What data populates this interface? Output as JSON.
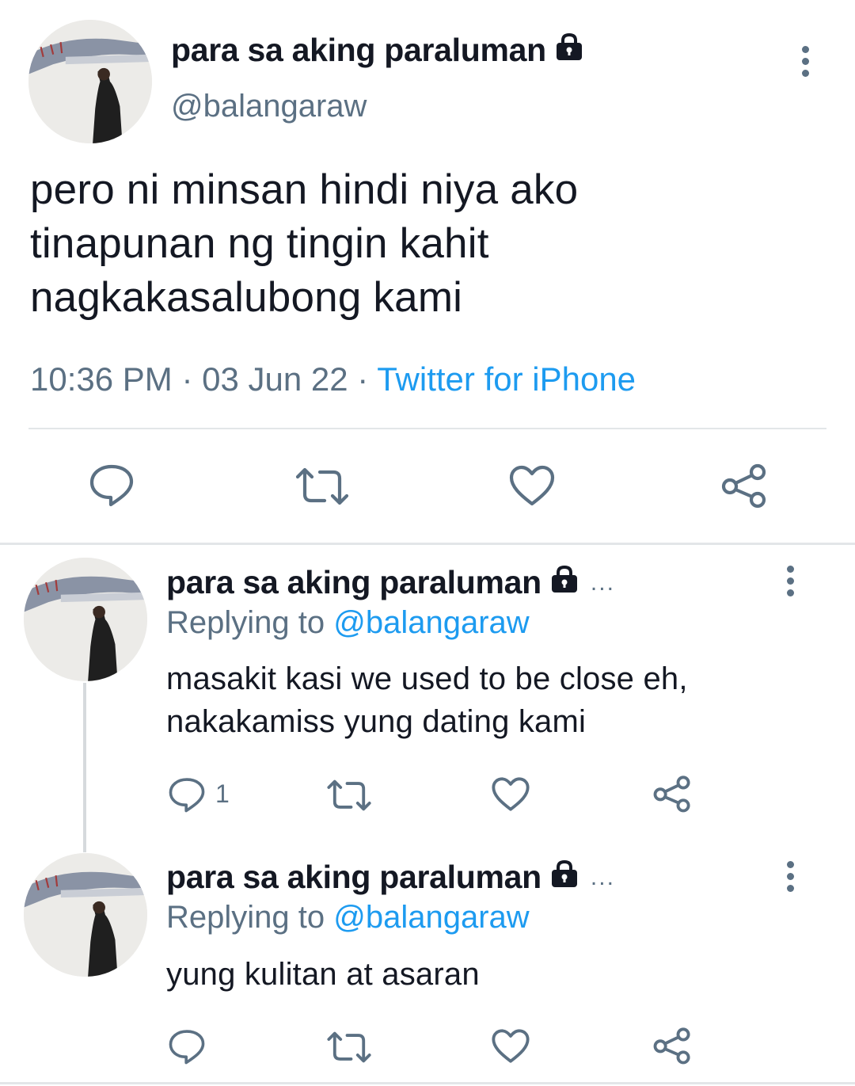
{
  "main_tweet": {
    "display_name": "para sa aking paraluman",
    "protected_icon": "lock-icon",
    "handle": "@balangaraw",
    "text_lines": [
      "pero ni minsan hindi niya ako",
      "tinapunan ng tingin kahit",
      "nagkakasalubong kami"
    ],
    "time": "10:36 PM",
    "date": "03 Jun 22",
    "separator": "·",
    "source": "Twitter for iPhone",
    "actions": [
      "reply-icon",
      "retweet-icon",
      "like-icon",
      "share-icon"
    ]
  },
  "replies": [
    {
      "display_name": "para sa aking paraluman",
      "ellipsis": "...",
      "replying_prefix": "Replying to",
      "replying_to": "@balangaraw",
      "text_lines": [
        "masakit kasi we used to be close eh,",
        "nakakamiss yung dating kami"
      ],
      "reply_count": "1"
    },
    {
      "display_name": "para sa aking paraluman",
      "ellipsis": "...",
      "replying_prefix": "Replying to",
      "replying_to": "@balangaraw",
      "text_lines": [
        "yung kulitan at asaran"
      ],
      "reply_count": ""
    }
  ],
  "colors": {
    "text": "#141823",
    "secondary": "#5b7083",
    "link": "#1d9bf0",
    "divider": "#e3e6e8"
  }
}
